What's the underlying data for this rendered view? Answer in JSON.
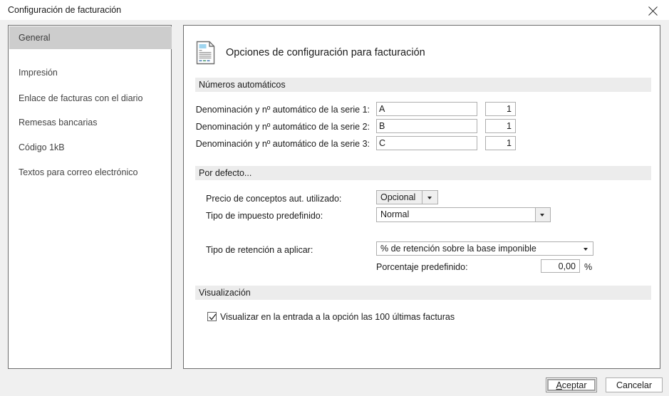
{
  "window": {
    "title": "Configuración de facturación",
    "close_icon": "close-icon"
  },
  "sidebar": {
    "items": [
      {
        "label": "General",
        "selected": true
      },
      {
        "label": "Impresión",
        "selected": false
      },
      {
        "label": "Enlace de facturas con el diario",
        "selected": false
      },
      {
        "label": "Remesas bancarias",
        "selected": false
      },
      {
        "label": "Código 1kB",
        "selected": false
      },
      {
        "label": "Textos para correo electrónico",
        "selected": false
      }
    ]
  },
  "main": {
    "header": {
      "icon": "document-settings-icon",
      "title": "Opciones de configuración para facturación"
    },
    "sections": {
      "numeros": {
        "band": "Números automáticos",
        "rows": [
          {
            "label": "Denominación y nº automático de la serie 1:",
            "name": "A",
            "number": "1"
          },
          {
            "label": "Denominación y nº automático de la serie 2:",
            "name": "B",
            "number": "1"
          },
          {
            "label": "Denominación y nº automático de la serie 3:",
            "name": "C",
            "number": "1"
          }
        ]
      },
      "por_defecto": {
        "band": "Por defecto...",
        "precio_label": "Precio de conceptos aut. utilizado:",
        "precio_value": "Opcional",
        "impuesto_label": "Tipo de impuesto predefinido:",
        "impuesto_value": "Normal",
        "retencion_label": "Tipo de retención a aplicar:",
        "retencion_value": "% de retención sobre la base imponible",
        "porcentaje_label": "Porcentaje predefinido:",
        "porcentaje_value": "0,00",
        "porcentaje_suffix": "%"
      },
      "visualizacion": {
        "band": "Visualización",
        "checkbox_label": "Visualizar en la entrada a la opción las 100 últimas facturas",
        "checkbox_checked": true
      }
    }
  },
  "footer": {
    "accept_accel": "A",
    "accept_rest": "ceptar",
    "cancel_label": "Cancelar"
  },
  "colors": {
    "dialog_bg": "#f0f0f0",
    "panel_bg": "#ffffff",
    "band_bg": "#ececec",
    "selected_bg": "#cdcdcd",
    "border": "#6d6d6d",
    "icon_accent": "#9fd5ef"
  }
}
